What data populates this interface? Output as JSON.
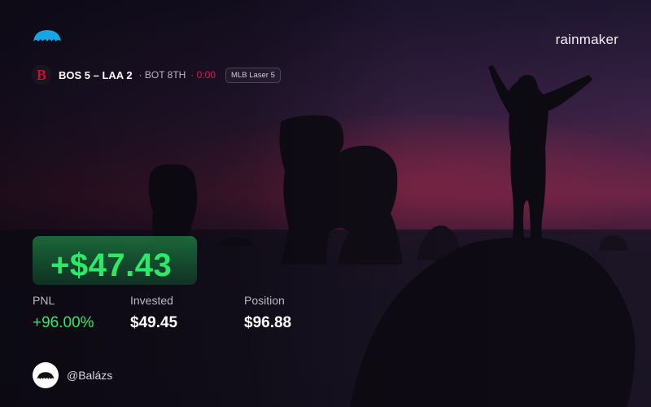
{
  "header": {
    "brand": "rainmaker",
    "logo_icon": "umbrella-icon",
    "accent": "#19a4e6"
  },
  "game": {
    "team_icon": "red-sox-b-icon",
    "score": "BOS 5 – LAA 2",
    "inning": "· BOT 8TH",
    "clock": "· 0:00",
    "market": "MLB Laser 5"
  },
  "pnl": {
    "value": "+$47.43",
    "color": "#2ee86a"
  },
  "stats": {
    "pnl_label": "PNL",
    "pnl_pct": "+96.00%",
    "invested_label": "Invested",
    "invested_value": "$49.45",
    "position_label": "Position",
    "position_value": "$96.88"
  },
  "user": {
    "avatar_icon": "umbrella-icon",
    "handle": "@Balázs"
  }
}
